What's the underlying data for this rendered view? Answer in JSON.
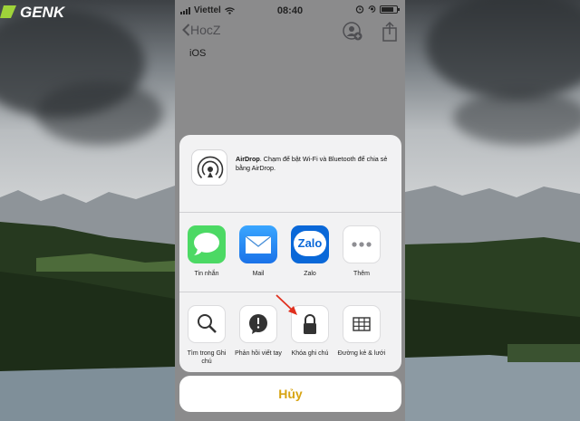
{
  "status_bar": {
    "carrier": "Viettel",
    "time": "08:40"
  },
  "nav": {
    "back_label": "HocZ"
  },
  "note": {
    "text": "iOS"
  },
  "airdrop": {
    "title": "AirDrop",
    "description": ". Chạm để bật Wi-Fi và Bluetooth để chia sẻ bằng AirDrop."
  },
  "apps": [
    {
      "label": "Tin nhắn",
      "icon": "messages-icon"
    },
    {
      "label": "Mail",
      "icon": "mail-icon"
    },
    {
      "label": "Zalo",
      "icon": "zalo-icon",
      "logo_text": "Zalo"
    },
    {
      "label": "Thêm",
      "icon": "more-icon"
    }
  ],
  "actions": [
    {
      "label": "Tìm trong Ghi chú",
      "icon": "magnifier-icon"
    },
    {
      "label": "Phản hồi viết tay",
      "icon": "markup-icon"
    },
    {
      "label": "Khóa ghi chú",
      "icon": "lock-icon"
    },
    {
      "label": "Đường kẻ & lưới",
      "icon": "grid-icon"
    }
  ],
  "cancel_label": "Hủy",
  "watermark": "GENK",
  "colors": {
    "accent_cancel": "#d7a413",
    "messages": "#4cd964",
    "mail": "#1f8cf2",
    "zalo": "#0a68d8",
    "arrow": "#e0301e"
  }
}
